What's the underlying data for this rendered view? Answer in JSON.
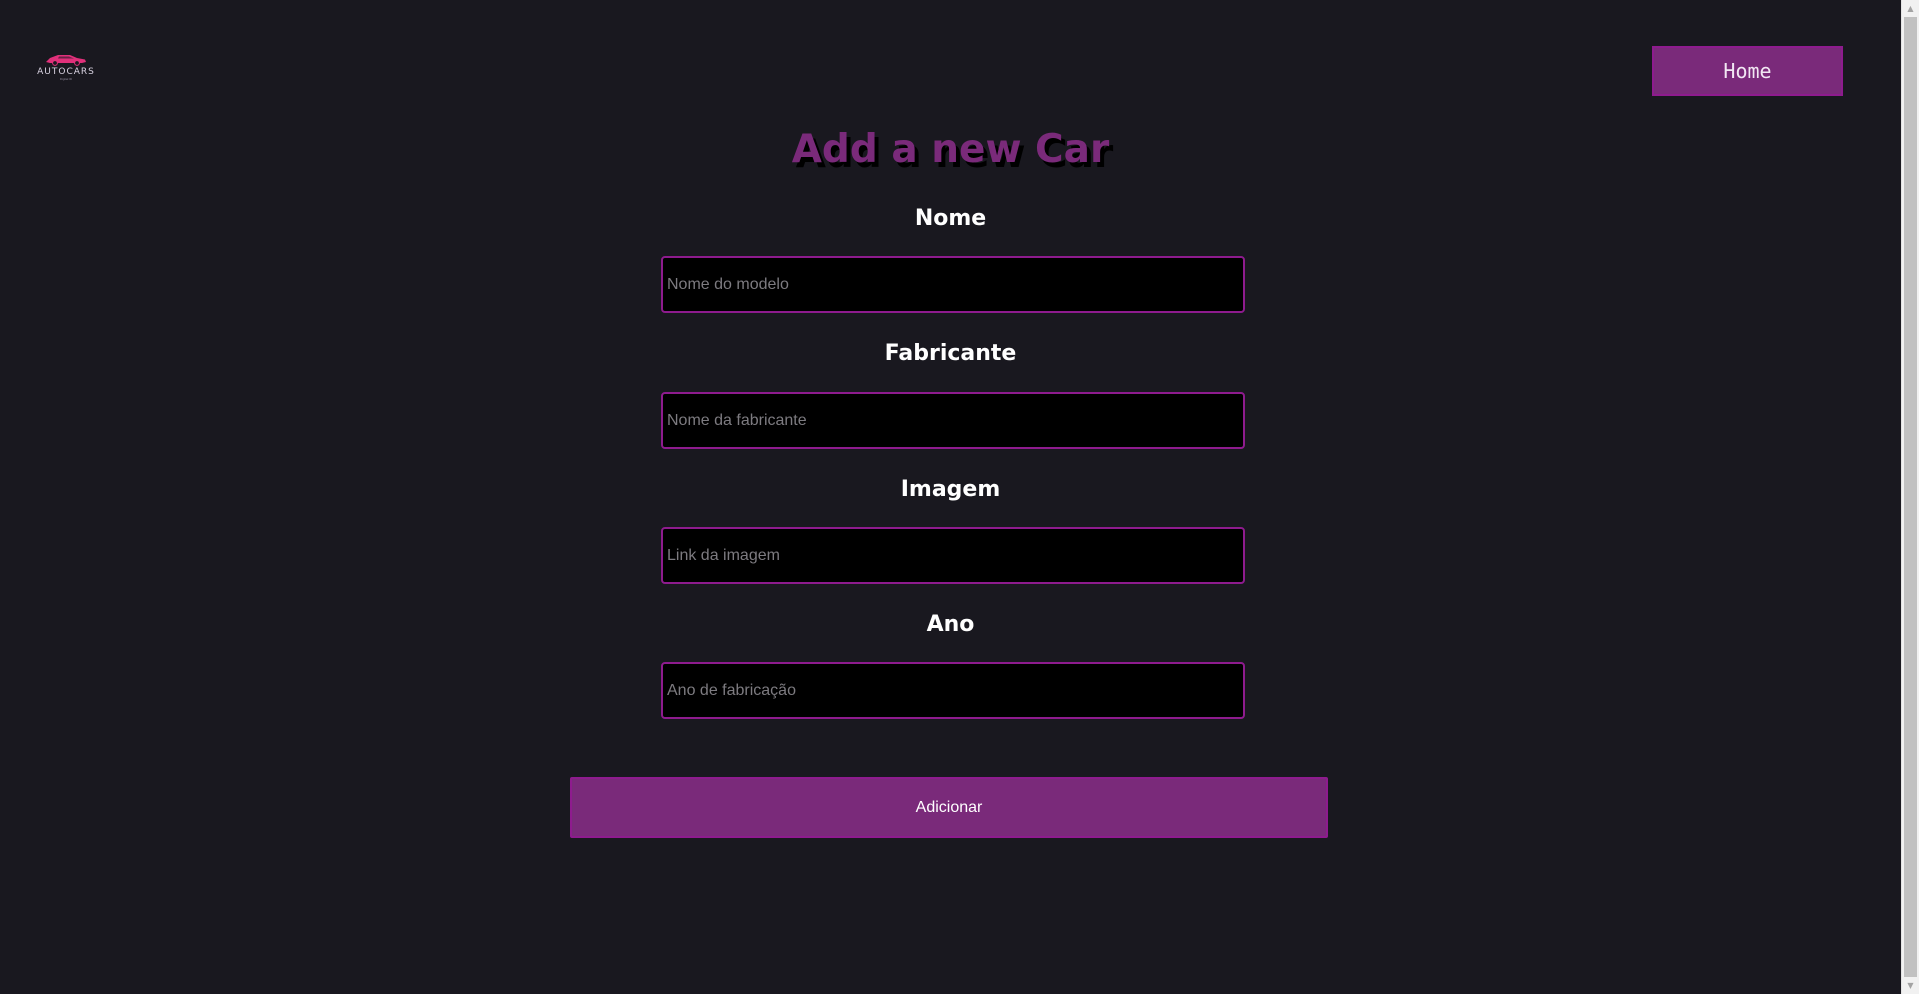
{
  "header": {
    "logo_text": "AUTOCARS",
    "logo_subtext": "Digital ID",
    "home_label": "Home"
  },
  "form": {
    "title": "Add a new Car",
    "fields": [
      {
        "label": "Nome",
        "placeholder": "Nome do modelo",
        "value": ""
      },
      {
        "label": "Fabricante",
        "placeholder": "Nome da fabricante",
        "value": ""
      },
      {
        "label": "Imagem",
        "placeholder": "Link da imagem",
        "value": ""
      },
      {
        "label": "Ano",
        "placeholder": "Ano de fabricação",
        "value": ""
      }
    ],
    "submit_label": "Adicionar"
  },
  "colors": {
    "background": "#19181f",
    "accent": "#7a2a7a",
    "accent_border": "#8e1b8e",
    "logo_pink": "#e0307a",
    "input_bg": "#000000"
  }
}
